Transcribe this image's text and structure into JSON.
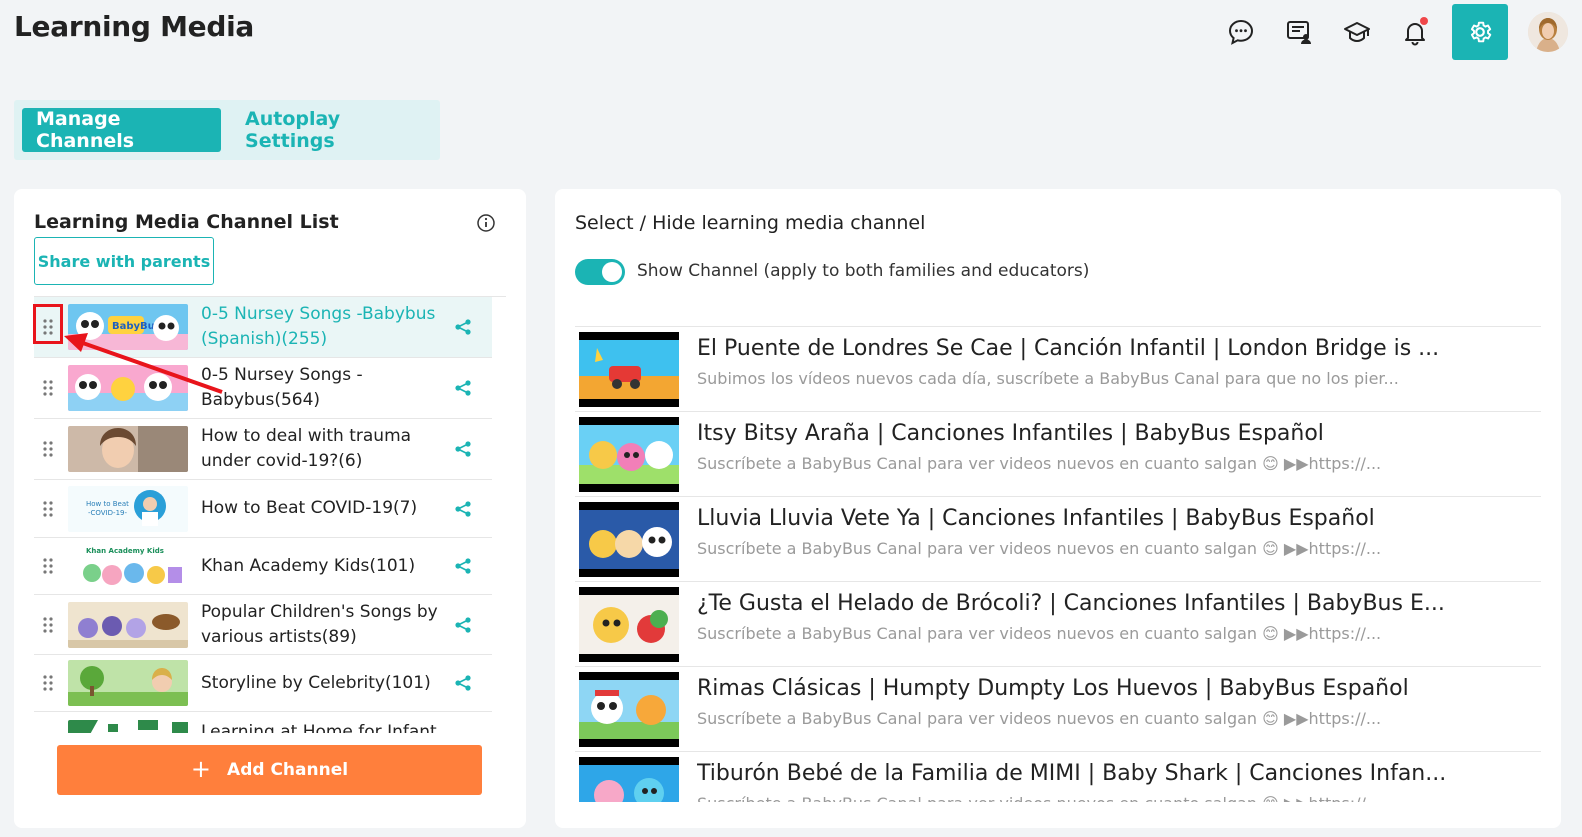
{
  "app": {
    "title": "Learning Media"
  },
  "top_icons": [
    {
      "name": "chat-icon"
    },
    {
      "name": "board-icon"
    },
    {
      "name": "graduation-cap-icon"
    },
    {
      "name": "bell-icon"
    },
    {
      "name": "gear-icon"
    }
  ],
  "tabs": [
    {
      "label": "Manage Channels",
      "active": true
    },
    {
      "label": "Autoplay Settings",
      "active": false
    }
  ],
  "channel_panel": {
    "title": "Learning Media Channel List",
    "share_label": "Share with parents",
    "add_label": "Add Channel",
    "channels": [
      {
        "name": "0-5 Nursey Songs -Babybus (Spanish)(255)",
        "selected": true,
        "thumb": "babybus"
      },
      {
        "name": "0-5 Nursey Songs - Babybus(564)",
        "selected": false,
        "thumb": "babybus2"
      },
      {
        "name": "How to deal with trauma under covid-19?(6)",
        "selected": false,
        "thumb": "trauma"
      },
      {
        "name": "How to Beat COVID-19(7)",
        "selected": false,
        "thumb": "covid"
      },
      {
        "name": "Khan Academy Kids(101)",
        "selected": false,
        "thumb": "khan"
      },
      {
        "name": "Popular Children's Songs by various artists(89)",
        "selected": false,
        "thumb": "popular"
      },
      {
        "name": "Storyline by Celebrity(101)",
        "selected": false,
        "thumb": "storyline"
      },
      {
        "name": "Learning at Home for Infant",
        "selected": false,
        "thumb": "learning"
      }
    ]
  },
  "media_panel": {
    "title": "Select / Hide learning media channel",
    "toggle_label": "Show Channel (apply to both families and educators)",
    "toggle_on": true,
    "videos": [
      {
        "title": "El Puente de Londres Se Cae | Canción Infantil | London Bridge is ...",
        "desc": "Subimos los vídeos nuevos cada día, suscríbete a BabyBus Canal para que no los pier..."
      },
      {
        "title": "Itsy Bitsy Araña | Canciones Infantiles | BabyBus Español",
        "desc": "Suscríbete a BabyBus Canal para ver videos nuevos en cuanto salgan 😊 ▶▶https://..."
      },
      {
        "title": "Lluvia Lluvia Vete Ya | Canciones Infantiles | BabyBus Español",
        "desc": "Suscríbete a BabyBus Canal para ver videos nuevos en cuanto salgan 😊 ▶▶https://..."
      },
      {
        "title": "¿Te Gusta el Helado de Brócoli? | Canciones Infantiles | BabyBus E...",
        "desc": "Suscríbete a BabyBus Canal para ver videos nuevos en cuanto salgan 😊 ▶▶https://..."
      },
      {
        "title": "Rimas Clásicas | Humpty Dumpty Los Huevos | BabyBus Español",
        "desc": "Suscríbete a BabyBus Canal para ver videos nuevos en cuanto salgan 😊 ▶▶https://..."
      },
      {
        "title": "Tiburón Bebé de la Familia de MIMI | Baby Shark | Canciones Infan...",
        "desc": "Suscríbete a BabyBus Canal para ver videos nuevos en cuanto salgan 😊 ▶▶https://..."
      }
    ]
  },
  "colors": {
    "accent": "#1bb4b4",
    "orange": "#ff7f3c",
    "annotation": "#e8141b"
  }
}
